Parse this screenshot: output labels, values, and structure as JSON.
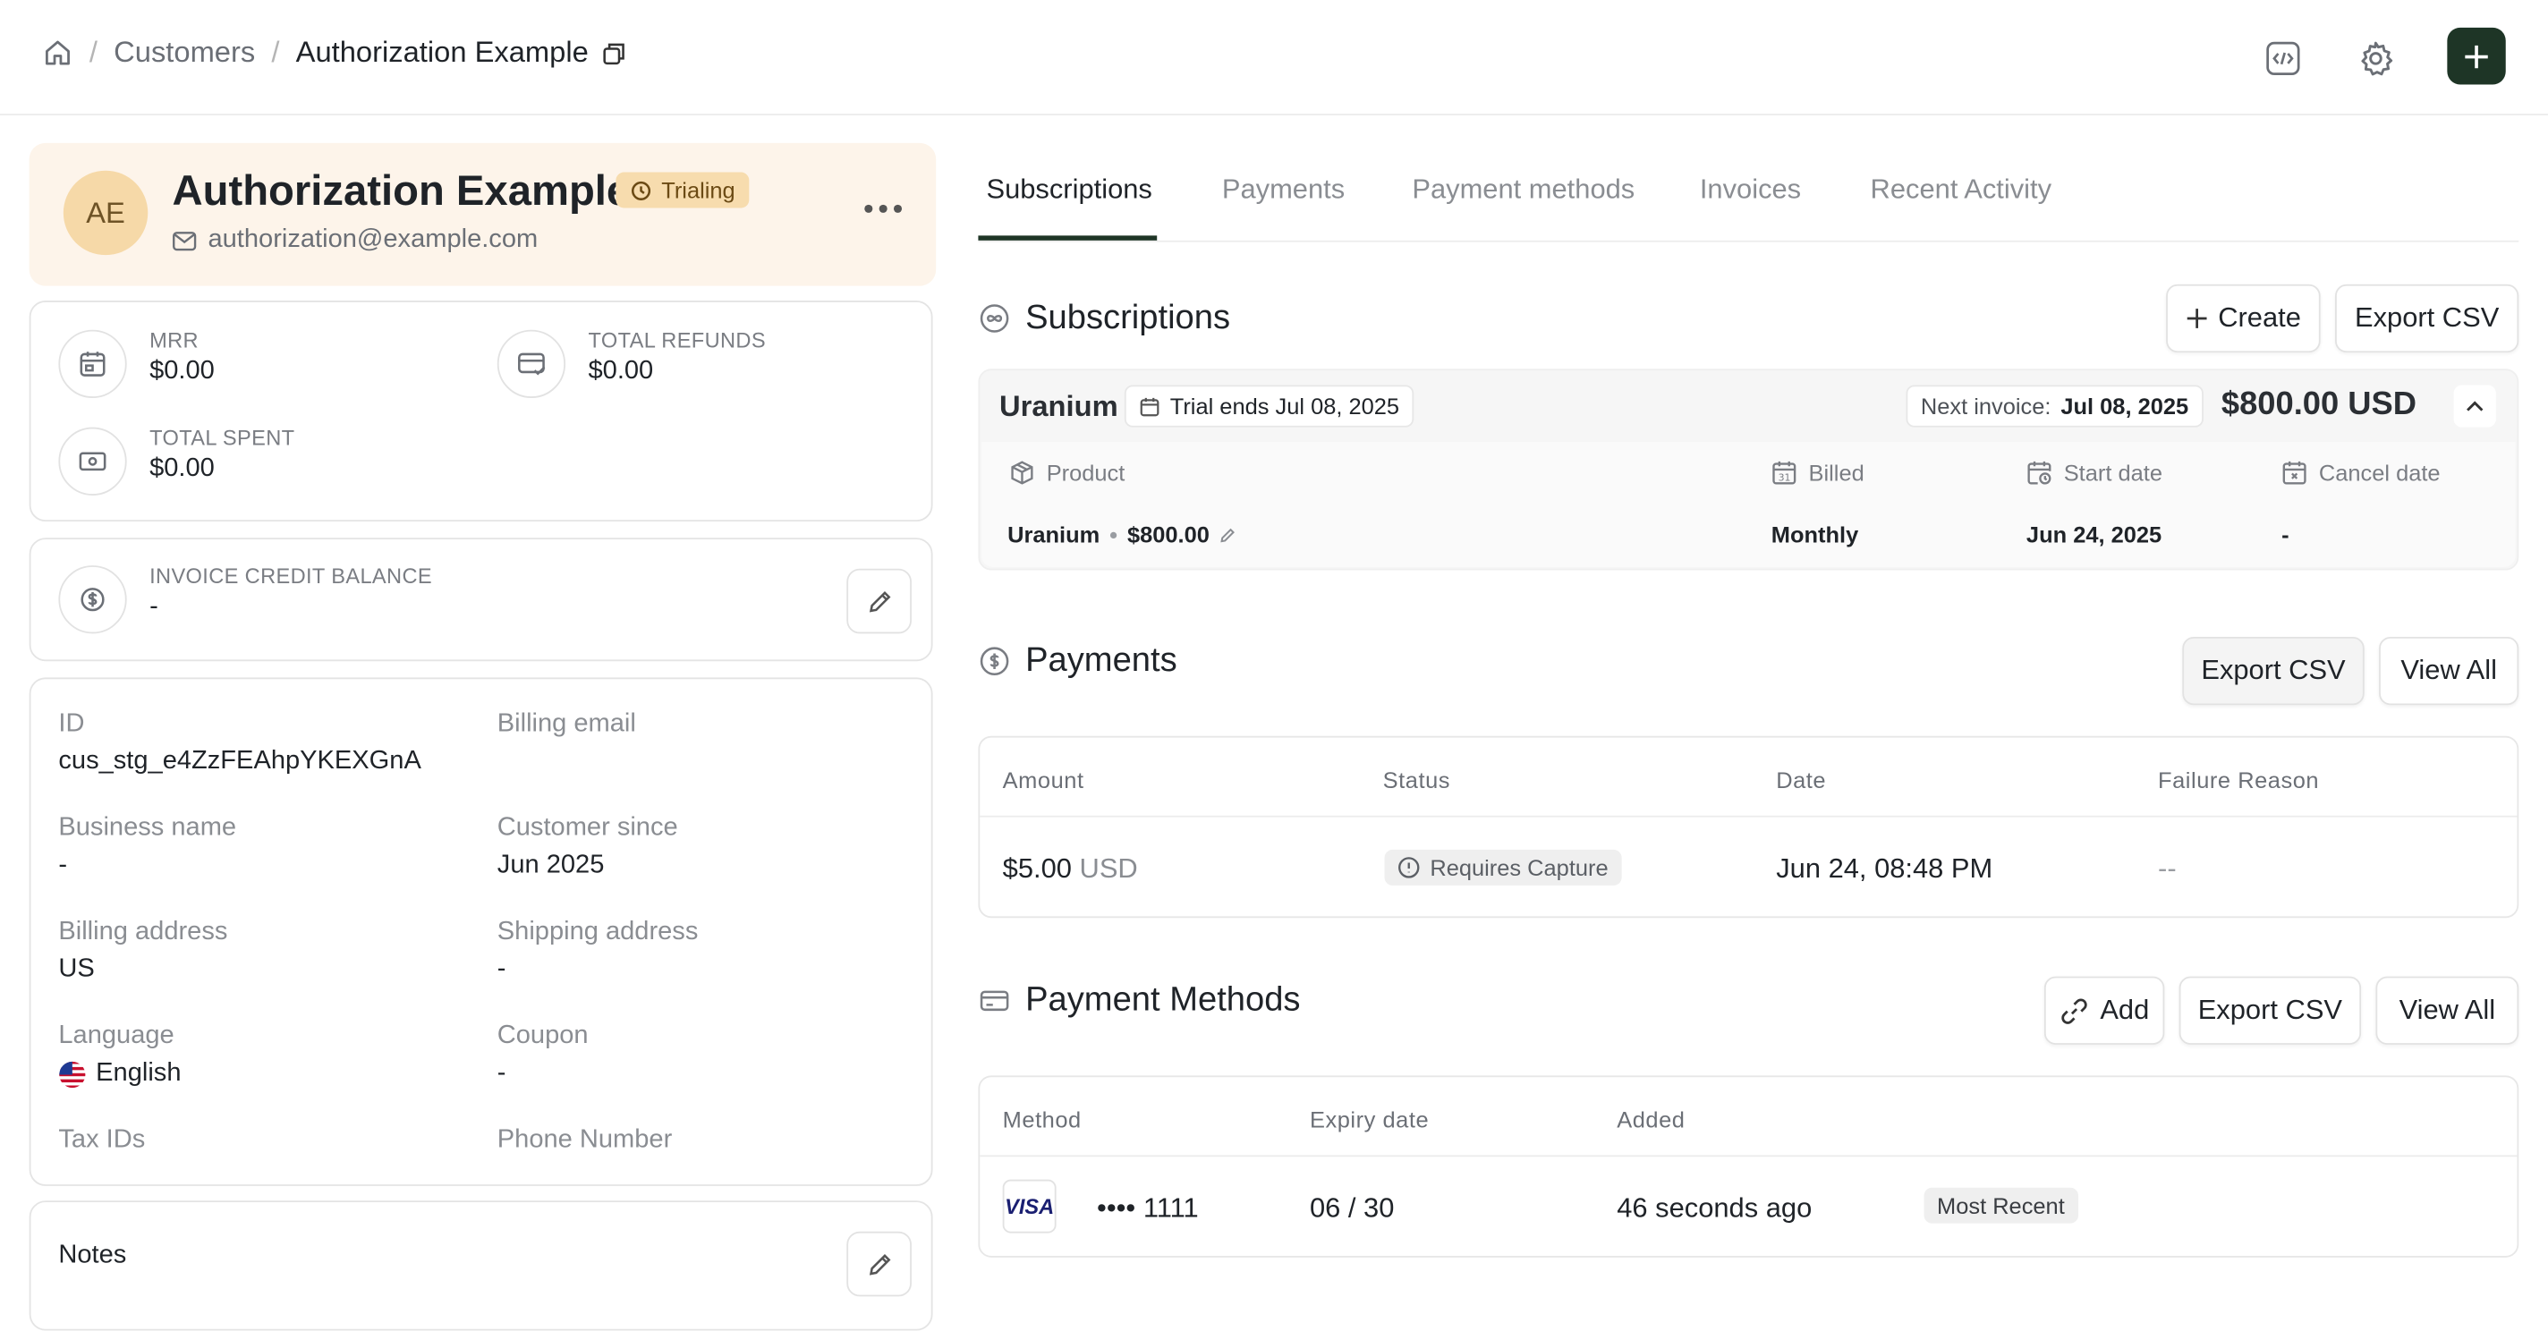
{
  "breadcrumb": {
    "customers": "Customers",
    "current": "Authorization Example"
  },
  "customer": {
    "initials": "AE",
    "name": "Authorization Example",
    "status": "Trialing",
    "email": "authorization@example.com"
  },
  "metrics": {
    "mrr_label": "MRR",
    "mrr_value": "$0.00",
    "refunds_label": "TOTAL REFUNDS",
    "refunds_value": "$0.00",
    "spent_label": "TOTAL SPENT",
    "spent_value": "$0.00"
  },
  "credit": {
    "label": "INVOICE CREDIT BALANCE",
    "value": "-"
  },
  "details": {
    "id_label": "ID",
    "id_value": "cus_stg_e4ZzFEAhpYKEXGnA",
    "billing_email_label": "Billing email",
    "business_name_label": "Business name",
    "business_name_value": "-",
    "customer_since_label": "Customer since",
    "customer_since_value": "Jun 2025",
    "billing_address_label": "Billing address",
    "billing_address_value": "US",
    "shipping_address_label": "Shipping address",
    "shipping_address_value": "-",
    "language_label": "Language",
    "language_value": "English",
    "coupon_label": "Coupon",
    "coupon_value": "-",
    "tax_ids_label": "Tax IDs",
    "phone_label": "Phone Number"
  },
  "notes": {
    "title": "Notes"
  },
  "tabs": [
    "Subscriptions",
    "Payments",
    "Payment methods",
    "Invoices",
    "Recent Activity"
  ],
  "subscriptions": {
    "title": "Subscriptions",
    "create_label": "Create",
    "export_label": "Export CSV",
    "plan_name": "Uranium",
    "trial_text": "Trial ends Jul 08, 2025",
    "next_invoice_label": "Next invoice:",
    "next_invoice_date": "Jul 08, 2025",
    "amount": "$800.00 USD",
    "col_product": "Product",
    "col_billed": "Billed",
    "col_start": "Start date",
    "col_cancel": "Cancel date",
    "row_product": "Uranium",
    "row_price": "$800.00",
    "row_billed": "Monthly",
    "row_start": "Jun 24, 2025",
    "row_cancel": "-"
  },
  "payments": {
    "title": "Payments",
    "export_label": "Export CSV",
    "view_all_label": "View All",
    "col_amount": "Amount",
    "col_status": "Status",
    "col_date": "Date",
    "col_failure": "Failure Reason",
    "row_amount": "$5.00",
    "row_currency": "USD",
    "row_status": "Requires Capture",
    "row_date": "Jun 24, 08:48 PM",
    "row_failure": "--"
  },
  "payment_methods": {
    "title": "Payment Methods",
    "add_label": "Add",
    "export_label": "Export CSV",
    "view_all_label": "View All",
    "col_method": "Method",
    "col_expiry": "Expiry date",
    "col_added": "Added",
    "card_brand": "VISA",
    "card_number": "•••• 1111",
    "expiry": "06 / 30",
    "added": "46 seconds ago",
    "badge": "Most Recent"
  }
}
